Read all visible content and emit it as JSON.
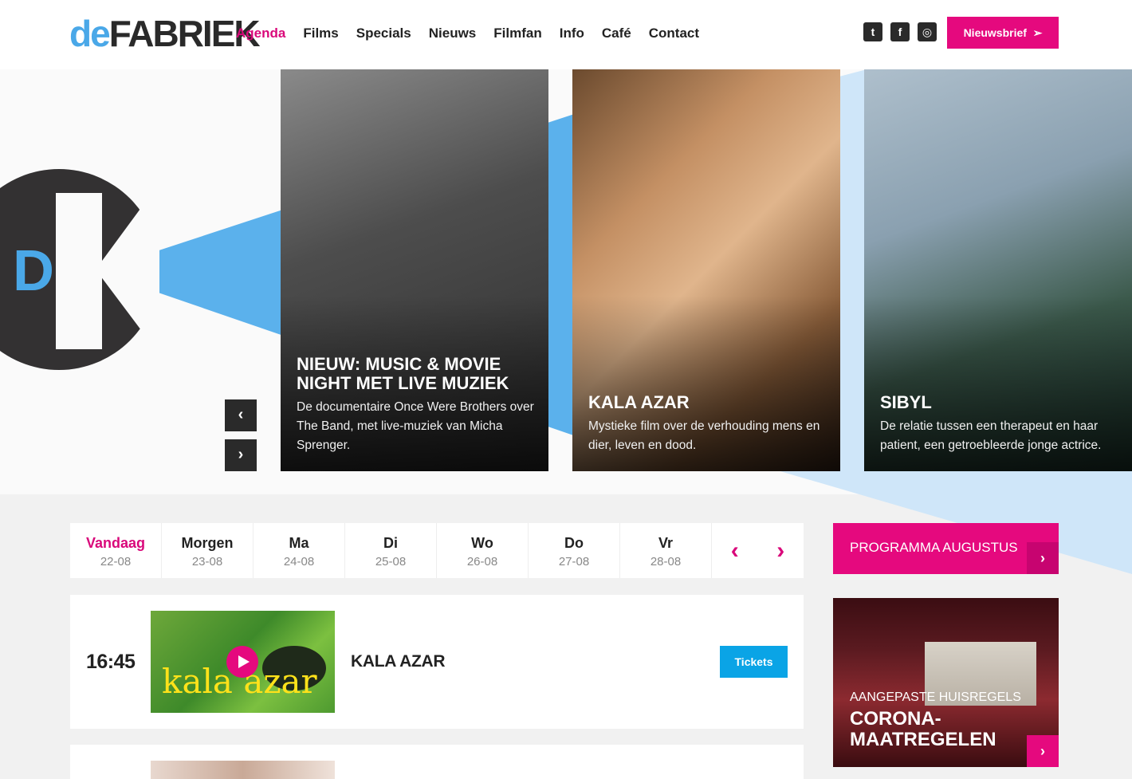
{
  "colors": {
    "accent": "#e5097e",
    "accent_text": "#d9087a",
    "beam": "#4aa8e8",
    "tickets": "#0aa4e6",
    "dark": "#2a2a2a"
  },
  "header": {
    "logo_de": "de",
    "logo_fabriek": "FABRIEK",
    "nav": [
      "Agenda",
      "Films",
      "Specials",
      "Nieuws",
      "Filmfan",
      "Info",
      "Café",
      "Contact"
    ],
    "active_nav": "Agenda",
    "socials": [
      "twitter-icon",
      "facebook-icon",
      "instagram-icon"
    ],
    "newsletter_label": "Nieuwsbrief"
  },
  "hero": {
    "mark_letter": "D",
    "prev_icon": "chevron-left-icon",
    "next_icon": "chevron-right-icon",
    "cards": [
      {
        "title": "NIEUW: MUSIC & MOVIE NIGHT MET LIVE MUZIEK",
        "desc": "De documentaire Once Were Brothers over The Band, met live-muziek van Micha Sprenger."
      },
      {
        "title": "KALA AZAR",
        "desc": "Mystieke film over de verhouding mens en dier, leven en dood."
      },
      {
        "title": "SIBYL",
        "desc": "De relatie tussen een therapeut en haar patient, een getroebleerde jonge actrice."
      }
    ]
  },
  "agenda": {
    "days": [
      {
        "name": "Vandaag",
        "date": "22-08"
      },
      {
        "name": "Morgen",
        "date": "23-08"
      },
      {
        "name": "Ma",
        "date": "24-08"
      },
      {
        "name": "Di",
        "date": "25-08"
      },
      {
        "name": "Wo",
        "date": "26-08"
      },
      {
        "name": "Do",
        "date": "27-08"
      },
      {
        "name": "Vr",
        "date": "28-08"
      }
    ],
    "active_day": "Vandaag",
    "listings": [
      {
        "time": "16:45",
        "poster_text": "kala azar",
        "title": "KALA AZAR",
        "tickets_label": "Tickets"
      }
    ]
  },
  "sidebar": {
    "programme_label": "PROGRAMMA AUGUSTUS",
    "corona_sub": "AANGEPASTE HUISREGELS",
    "corona_title": "CORONA-MAATREGELEN"
  }
}
